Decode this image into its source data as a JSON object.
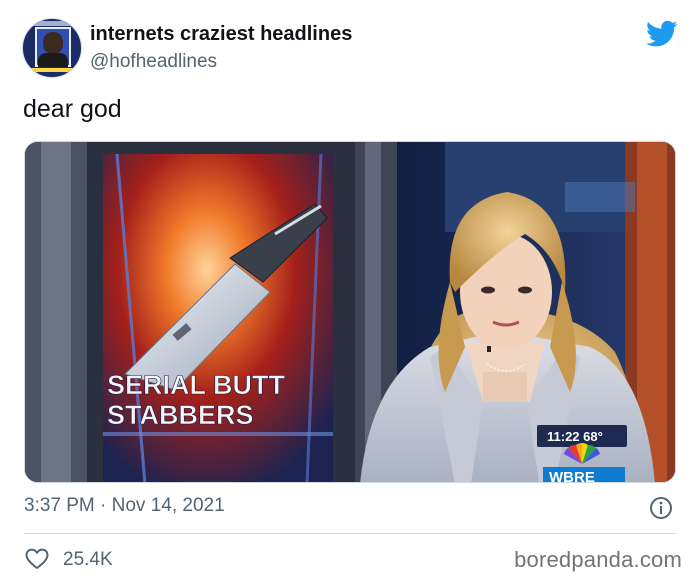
{
  "tweet": {
    "display_name": "internets craziest headlines",
    "handle": "@hofheadlines",
    "text": "dear god",
    "meta": "3:37 PM · Nov 14, 2021",
    "likes": "25.4K"
  },
  "media": {
    "graphic_text_line1": "SERIAL BUTT",
    "graphic_text_line2": "STABBERS",
    "bug_time": "11:22 68°",
    "bug_station": "WBRE"
  },
  "icons": {
    "brand": "twitter-bird-icon",
    "info": "info-icon",
    "like": "heart-icon"
  },
  "colors": {
    "twitter_blue": "#1d9bf0",
    "secondary_text": "#536471"
  },
  "watermark": "boredpanda.com"
}
